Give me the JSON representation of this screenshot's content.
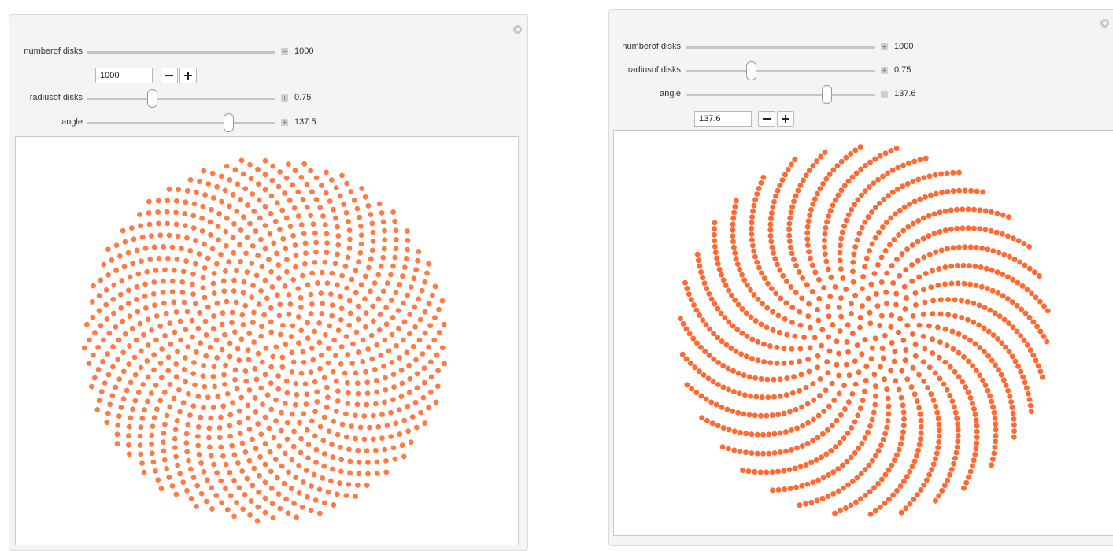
{
  "panels": [
    {
      "id": "left",
      "controls": {
        "number_of_disks": {
          "label": "numberof disks",
          "value": "1000",
          "expanded": true,
          "input_value": "1000"
        },
        "radius_of_disks": {
          "label": "radiusof disks",
          "value": "0.75",
          "expanded": false
        },
        "angle": {
          "label": "angle",
          "value": "137.5",
          "expanded": false
        }
      },
      "plot": {
        "disks": 1000,
        "radius": 0.75,
        "angle_deg": 137.5,
        "disk_color": "#ff7a45"
      }
    },
    {
      "id": "right",
      "controls": {
        "number_of_disks": {
          "label": "numberof disks",
          "value": "1000",
          "expanded": false
        },
        "radius_of_disks": {
          "label": "radiusof disks",
          "value": "0.75",
          "expanded": false
        },
        "angle": {
          "label": "angle",
          "value": "137.6",
          "expanded": true,
          "input_value": "137.6"
        }
      },
      "plot": {
        "disks": 1000,
        "radius": 0.75,
        "angle_deg": 137.6,
        "disk_color": "#ff6a33"
      }
    }
  ],
  "icons": {
    "panel_options": "gear-icon",
    "open_controls": "plus-icon",
    "close_controls": "minus-icon",
    "step_down": "minus-icon",
    "step_up": "plus-icon"
  },
  "colors": {
    "panel_bg": "#f4f4f4",
    "disk_left": "#ff7a45",
    "disk_right": "#ff6a33"
  }
}
